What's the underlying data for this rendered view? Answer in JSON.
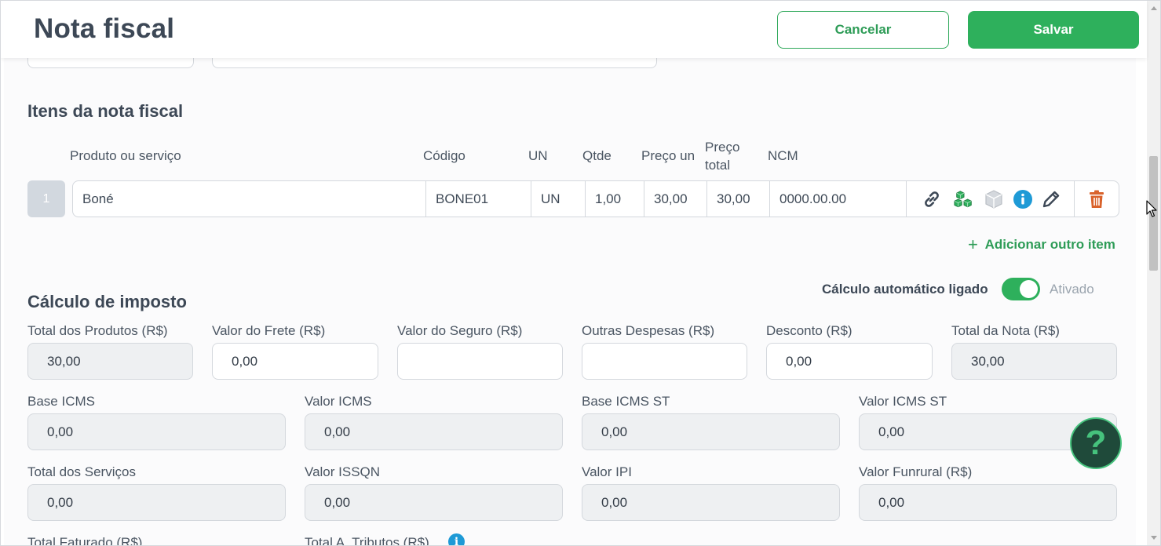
{
  "header": {
    "title": "Nota fiscal",
    "cancel_label": "Cancelar",
    "save_label": "Salvar"
  },
  "items_section": {
    "title": "Itens da nota fiscal",
    "columns": {
      "product": "Produto ou serviço",
      "code": "Código",
      "unit": "UN",
      "qty": "Qtde",
      "unit_price": "Preço un",
      "total_price_line1": "Preço",
      "total_price_line2": "total",
      "ncm": "NCM"
    },
    "rows": [
      {
        "number": "1",
        "product": "Boné",
        "code": "BONE01",
        "unit": "UN",
        "qty": "1,00",
        "unit_price": "30,00",
        "total_price": "30,00",
        "ncm": "0000.00.00",
        "action_icons": [
          "link-icon",
          "cubes-icon",
          "box-icon",
          "info-icon",
          "pencil-icon",
          "trash-icon"
        ]
      }
    ],
    "add_item_label": "Adicionar outro item"
  },
  "tax_section": {
    "title": "Cálculo de imposto",
    "auto_calc_label": "Cálculo automático ligado",
    "auto_calc_on": true,
    "auto_calc_status": "Ativado",
    "fields": {
      "total_produtos": {
        "label": "Total dos Produtos (R$)",
        "value": "30,00",
        "readonly": true
      },
      "valor_frete": {
        "label": "Valor do Frete (R$)",
        "value": "0,00",
        "readonly": false
      },
      "valor_seguro": {
        "label": "Valor do Seguro (R$)",
        "value": "",
        "readonly": false
      },
      "outras_despesas": {
        "label": "Outras Despesas (R$)",
        "value": "",
        "readonly": false
      },
      "desconto": {
        "label": "Desconto (R$)",
        "value": "0,00",
        "readonly": false
      },
      "total_nota": {
        "label": "Total da Nota (R$)",
        "value": "30,00",
        "readonly": true
      },
      "base_icms": {
        "label": "Base ICMS",
        "value": "0,00",
        "readonly": true
      },
      "valor_icms": {
        "label": "Valor ICMS",
        "value": "0,00",
        "readonly": true
      },
      "base_icms_st": {
        "label": "Base ICMS ST",
        "value": "0,00",
        "readonly": true
      },
      "valor_icms_st": {
        "label": "Valor ICMS ST",
        "value": "0,00",
        "readonly": true
      },
      "total_servicos": {
        "label": "Total dos Serviços",
        "value": "0,00",
        "readonly": true
      },
      "valor_issqn": {
        "label": "Valor ISSQN",
        "value": "0,00",
        "readonly": true
      },
      "valor_ipi": {
        "label": "Valor IPI",
        "value": "0,00",
        "readonly": true
      },
      "valor_funrural": {
        "label": "Valor Funrural (R$)",
        "value": "0,00",
        "readonly": true
      },
      "total_faturado": {
        "label": "Total Faturado (R$)"
      },
      "total_tributos": {
        "label": "Total A. Tributos (R$)"
      }
    }
  },
  "help_button": {
    "label": "?"
  },
  "colors": {
    "brand_green": "#2eb05c",
    "text_dark": "#3d4856",
    "readonly_bg": "#eef0f2",
    "delete_orange": "#d9622b",
    "info_blue": "#1e9ad6"
  }
}
